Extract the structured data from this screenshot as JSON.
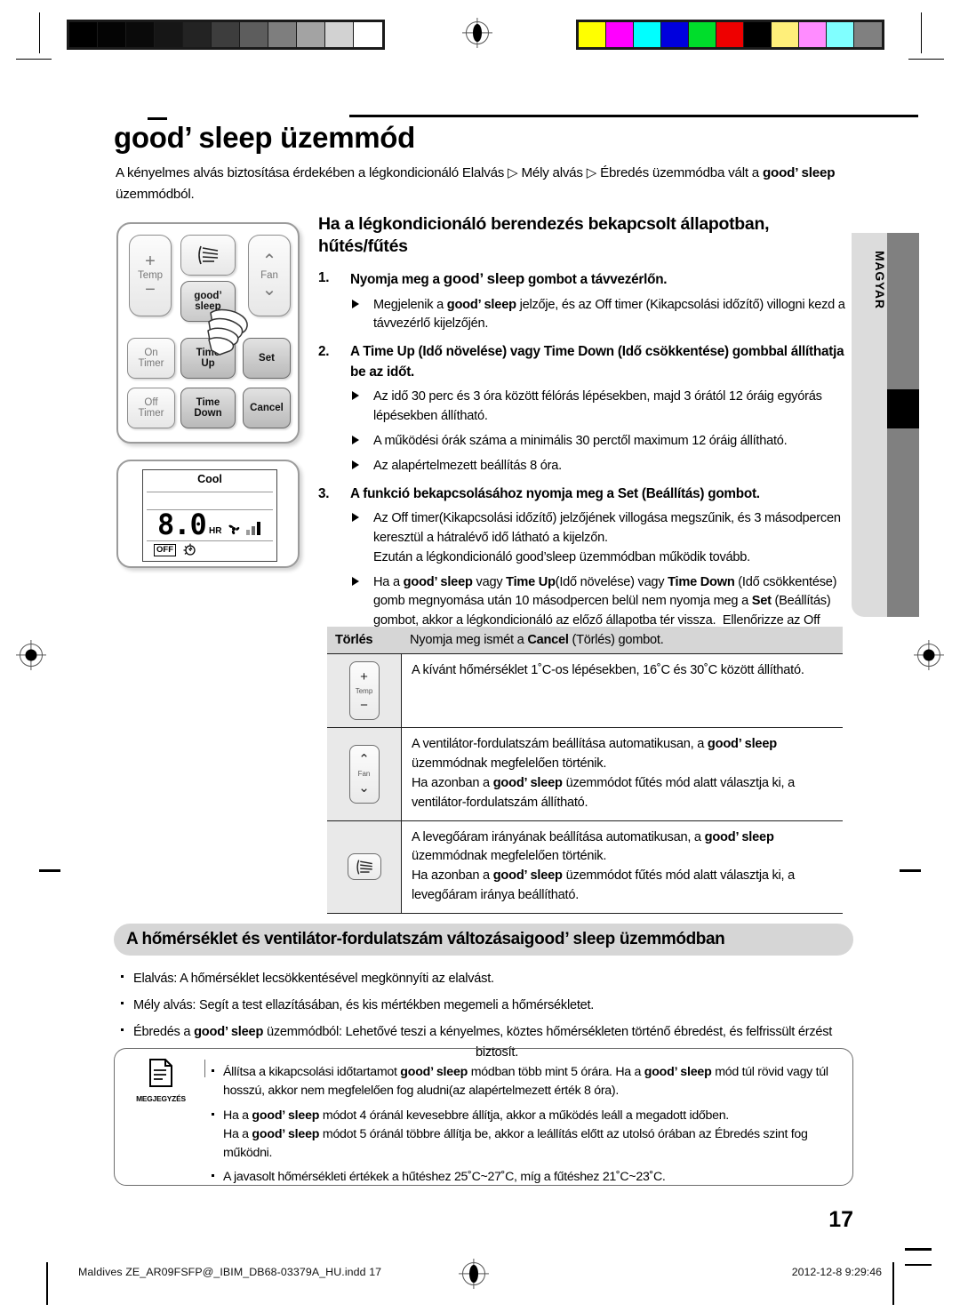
{
  "document": {
    "title": "good’ sleep üzemmód",
    "intro": "A kényelmes alvás biztosítása érdekében a légkondicionáló Elalvás ▷ Mély alvás ▷ Ébredés üzemmódba vált a good’ sleep üzemmódból.",
    "language_tab": "MAGYAR",
    "page_number": "17"
  },
  "remote": {
    "buttons": [
      {
        "name": "temp",
        "label": "Temp",
        "plus": "+",
        "minus": "−"
      },
      {
        "name": "swing",
        "label": "",
        "icon": "air-swing-icon"
      },
      {
        "name": "fan",
        "label": "Fan",
        "up": "⌃",
        "down": "⌄"
      },
      {
        "name": "good-sleep",
        "label": "good’\nsleep"
      },
      {
        "name": "on-timer",
        "label": "On\nTimer"
      },
      {
        "name": "time-up",
        "label": "Time\nUp"
      },
      {
        "name": "set",
        "label": "Set"
      },
      {
        "name": "off-timer",
        "label": "Off\nTimer"
      },
      {
        "name": "time-down",
        "label": "Time\nDown"
      },
      {
        "name": "cancel",
        "label": "Cancel"
      }
    ],
    "button_labels": {
      "temp": "Temp",
      "fan": "Fan",
      "good_line1": "good’",
      "good_line2": "sleep",
      "on_line1": "On",
      "on_line2": "Timer",
      "time_up_line1": "Time",
      "time_up_line2": "Up",
      "set": "Set",
      "off_line1": "Off",
      "off_line2": "Timer",
      "time_down_line1": "Time",
      "time_down_line2": "Down",
      "cancel": "Cancel"
    }
  },
  "lcd": {
    "mode": "Cool",
    "value": "8.0",
    "unit": "HR",
    "off_badge": "OFF"
  },
  "section1": {
    "heading": "Ha a légkondicionáló berendezés bekapcsolt állapotban, hűtés/fűtés",
    "steps": [
      {
        "num": "1.",
        "text_pre": "Nyomja meg a ",
        "text_gs": "good’ sleep",
        "text_post": " gombot a távvezérlőn.",
        "subs": [
          "Megjelenik a good’ sleep jelzője, és az Off timer (Kikapcsolási időzítő) villogni kezd a távvezérlő kijelzőjén."
        ]
      },
      {
        "num": "2.",
        "text": "A Time Up (Idő növelése) vagy Time Down (Idő csökkentése) gombbal állíthatja be az időt.",
        "subs": [
          "Az idő 30 perc és 3 óra között félórás lépésekben, majd 3 órától 12 óráig egyórás lépésekben állítható.",
          "A működési órák száma a minimális 30 perctől maximum 12 óráig állítható.",
          "Az alapértelmezett beállítás 8 óra."
        ]
      },
      {
        "num": "3.",
        "text": "A funkció bekapcsolásához nyomja meg a Set (Beállítás) gombot.",
        "subs": [
          "Az Off timer(Kikapcsolási időzítő) jelzőjének villogása megszűnik, és 3 másodpercen keresztül a hátralévő idő látható a kijelzőn. Ezután a légkondicionáló good’sleep üzemmódban működik tovább.",
          "Ha a good’ sleep vagy Time Up(Idő növelése) vagy Time Down (Idő csökkentése) gomb megnyomása után 10 másodpercen belül nem nyomja meg a Set (Beállítás) gombot, akkor a légkondicionáló az előző állapotba tér vissza.  Ellenőrizze az Off timer(Kikapcsolási időzítő) jelzőjét, valamint a beltéri egységen lévő ☼ jelzőfényt."
        ]
      }
    ]
  },
  "table": {
    "header_key": "Törlés",
    "header_value": "Nyomja meg ismét a Cancel (Törlés) gombot.",
    "rows": [
      {
        "icon": "temp-button-icon",
        "icon_label": "Temp",
        "lines": [
          "A kívánt hőmérséklet 1˚C-os lépésekben, 16˚C és 30˚C között állítható."
        ]
      },
      {
        "icon": "fan-button-icon",
        "icon_label": "Fan",
        "lines": [
          "A ventilátor-fordulatszám beállítása automatikusan, a good’ sleep üzemmódnak megfelelően történik.",
          "Ha azonban a good’ sleep üzemmódot fűtés mód alatt választja ki, a ventilátor-fordulatszám állítható."
        ]
      },
      {
        "icon": "air-swing-button-icon",
        "icon_label": "",
        "lines": [
          "A levegőáram irányának beállítása automatikusan, a good’ sleep üzemmódnak megfelelően történik.",
          "Ha azonban a good’ sleep üzemmódot fűtés mód alatt választja ki, a levegőáram iránya beállítható."
        ]
      }
    ]
  },
  "section2": {
    "heading": "A hőmérséklet és ventilátor-fordulatszám változásai good’ sleep üzemmódban",
    "bullets": [
      "Elalvás:  A hőmérséklet lecsökkentésével megkönnyíti az elalvást.",
      "Mély alvás: Segít a test ellazításában, és kis mértékben megemeli a hőmérsékletet.",
      "Ébredés a good’ sleep üzemmódból: Lehetővé teszi a kényelmes, köztes hőmérsékleten történő ébredést, és felfrissült érzést biztosít."
    ],
    "bullet3_indent": "biztosít."
  },
  "note": {
    "icon_label": "MEGJEGYZÉS",
    "bullets": [
      "Állítsa a kikapcsolási időtartamot good’ sleep módban több mint 5 órára. Ha a good’ sleep mód túl rövid vagy túl hosszú, akkor nem megfelelően fog aludni(az alapértelmezett érték 8 óra).",
      "Ha a good’ sleep módot 4 óránál kevesebbre állítja, akkor a működés leáll a megadott időben. Ha a good’ sleep módot 5 óránál többre állítja be, akkor a leállítás előtt az utolsó órában az Ébredés szint fog működni.",
      "A javasolt hőmérsékleti értékek a hűtéshez 25˚C~27˚C, míg a fűtéshez 21˚C~23˚C."
    ]
  },
  "footer": {
    "left": "Maldives ZE_AR09FSFP@_IBIM_DB68-03379A_HU.indd   17",
    "right": "2012-12-8   9:29:46"
  },
  "calibration": {
    "grayscale": [
      "#000000",
      "#040404",
      "#0a0a0a",
      "#161616",
      "#232323",
      "#3d3d3d",
      "#5d5d5d",
      "#7e7e7e",
      "#a3a3a3",
      "#d2d2d2",
      "#ffffff"
    ],
    "colors": [
      "#ffff00",
      "#ff00ff",
      "#00ffff",
      "#0000dd",
      "#00dd2b",
      "#ee0000",
      "#000000",
      "#ffef7a",
      "#ff8cff",
      "#80ffff",
      "#808080"
    ]
  }
}
